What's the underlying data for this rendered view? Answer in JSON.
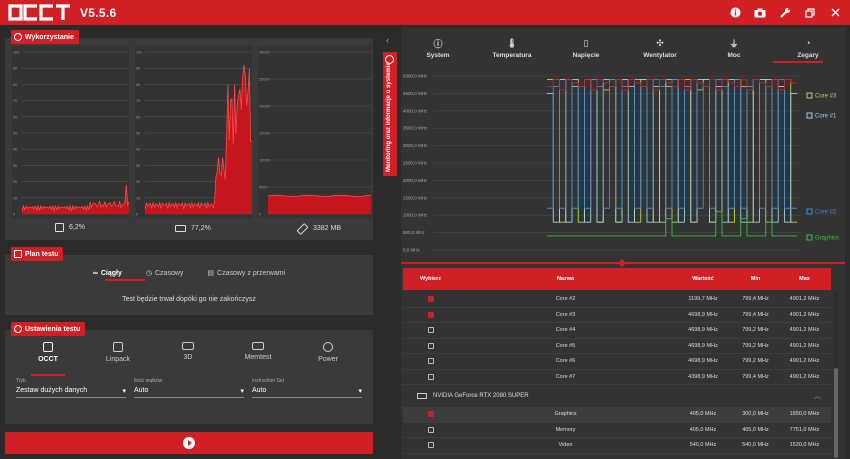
{
  "app": {
    "version": "V5.5.6"
  },
  "window_controls": [
    "info-icon",
    "camera-icon",
    "wrench-icon",
    "restore-icon",
    "close-icon"
  ],
  "usage": {
    "title": "Wykorzystanie",
    "graph1": {
      "y_ticks": [
        "100",
        "90",
        "80",
        "70",
        "60",
        "50",
        "40",
        "30",
        "20",
        "10",
        "0"
      ],
      "caption": "6,2%"
    },
    "graph2": {
      "y_ticks": [
        "100",
        "90",
        "80",
        "70",
        "60",
        "50",
        "40",
        "30",
        "20",
        "10",
        "0"
      ],
      "caption": "77,2%"
    },
    "graph3": {
      "y_ticks": [
        "30000",
        "25000",
        "20000",
        "15000",
        "10000",
        "5000",
        "0"
      ],
      "caption": "3382 MB"
    }
  },
  "plan": {
    "title": "Plan testu",
    "modes": [
      "Ciągły",
      "Czasowy",
      "Czasowy z przerwami"
    ],
    "active_mode": 0,
    "description": "Test będzie trwał dopóki go nie zakończysz"
  },
  "settings": {
    "title": "Ustawienia testu",
    "tests": [
      "OCCT",
      "Linpack",
      "3D",
      "Memtest",
      "Power"
    ],
    "active_test": 0,
    "selects": [
      {
        "label": "Tryb",
        "value": "Zestaw dużych danych"
      },
      {
        "label": "Ilość wątków",
        "value": "Auto"
      },
      {
        "label": "Instruction Set",
        "value": "Auto"
      }
    ]
  },
  "monitor_tab": {
    "label": "Monitoring oraz informacje o systemie"
  },
  "monitor": {
    "tabs": [
      "System",
      "Temperatura",
      "Napięcie",
      "Wentylator",
      "Moc",
      "Zegary"
    ],
    "tab_icons": [
      "info-icon",
      "thermometer-icon",
      "battery-icon",
      "fan-icon",
      "plug-icon",
      "gauge-icon"
    ],
    "active_tab": 5
  },
  "chart_data": {
    "type": "line",
    "y_ticks": [
      "5000,0 MHz",
      "4500,0 MHz",
      "4000,0 MHz",
      "3500,0 MHz",
      "3000,0 MHz",
      "2500,0 MHz",
      "2000,0 MHz",
      "1500,0 MHz",
      "1000,0 MHz",
      "500,0 MHz",
      "0,0 MHz"
    ],
    "ylim": [
      0,
      5000
    ],
    "legend": [
      "Core #3",
      "Core #1",
      "Core #2",
      "Graphics"
    ],
    "legend_colors": [
      "#b9d64a",
      "#9ad3e6",
      "#3b8fd9",
      "#3fbf3f"
    ],
    "series": [
      {
        "name": "Core #3",
        "color": "#b9d64a",
        "values": [
          4900,
          4900,
          800,
          4900,
          4700,
          800,
          4900,
          4900,
          800,
          4600,
          4900,
          800,
          4900,
          4700,
          800,
          4900,
          4900,
          800,
          4900,
          4700,
          800,
          4900,
          4900,
          800,
          4600,
          4900,
          800,
          4900,
          4900,
          800,
          4900,
          4700,
          800,
          4900,
          4900,
          800,
          4900,
          4700,
          4900,
          800
        ]
      },
      {
        "name": "Core #1",
        "color": "#9ad3e6",
        "values": [
          4500,
          800,
          4900,
          800,
          4900,
          4700,
          800,
          4900,
          800,
          4900,
          4700,
          800,
          4900,
          800,
          4900,
          4900,
          800,
          4700,
          800,
          4900,
          4900,
          800,
          4700,
          800,
          4900,
          4900,
          800,
          4700,
          800,
          4900,
          4900,
          800,
          4700,
          800,
          4900,
          4900,
          800,
          4700,
          800,
          4500
        ]
      },
      {
        "name": "Core #2",
        "color": "#3b8fd9",
        "values": [
          1200,
          4700,
          1200,
          4900,
          1200,
          4700,
          1200,
          4900,
          4700,
          1200,
          4900,
          1200,
          4700,
          4900,
          1200,
          4700,
          1200,
          4900,
          4700,
          1200,
          4900,
          1200,
          4700,
          4900,
          1200,
          4700,
          1200,
          4900,
          4700,
          1200,
          4900,
          1200,
          4700,
          4900,
          1200,
          4700,
          1200,
          4900,
          1200,
          1200
        ]
      },
      {
        "name": "Graphics",
        "color": "#3fbf3f",
        "values": [
          405,
          405,
          405,
          405,
          405,
          405,
          405,
          405,
          405,
          405,
          405,
          405,
          405,
          405,
          405,
          405,
          405,
          405,
          405,
          900,
          405,
          405,
          405,
          405,
          405,
          405,
          405,
          1100,
          405,
          405,
          405,
          900,
          405,
          405,
          405,
          800,
          405,
          405,
          405,
          405
        ]
      },
      {
        "name": "",
        "color": "#d01f25",
        "values": [
          4700,
          4900,
          4600,
          4900,
          4800,
          4700,
          4900,
          4600,
          4900,
          4800,
          4700,
          4900,
          4600,
          4900,
          4800,
          4700,
          4900,
          4600,
          4900,
          4800,
          4700,
          4900,
          4600,
          4900,
          4800,
          4700,
          4900,
          4600,
          4900,
          4800,
          4700,
          4900,
          4600,
          4900,
          4800,
          4700,
          4900,
          4600,
          4900,
          4800
        ]
      }
    ]
  },
  "table": {
    "headers": [
      "Wybierz",
      "Nazwa",
      "Wartość",
      "Min",
      "Max"
    ],
    "rows_cpu": [
      {
        "checked": true,
        "name": "Core #2",
        "value": "1199,7 MHz",
        "min": "799,4 MHz",
        "max": "4901,2 MHz"
      },
      {
        "checked": true,
        "name": "Core #3",
        "value": "4698,9 MHz",
        "min": "799,4 MHz",
        "max": "4901,2 MHz"
      },
      {
        "checked": false,
        "name": "Core #4",
        "value": "4698,9 MHz",
        "min": "799,2 MHz",
        "max": "4901,2 MHz"
      },
      {
        "checked": false,
        "name": "Core #5",
        "value": "4698,9 MHz",
        "min": "799,2 MHz",
        "max": "4901,2 MHz"
      },
      {
        "checked": false,
        "name": "Core #6",
        "value": "4698,9 MHz",
        "min": "799,2 MHz",
        "max": "4901,2 MHz"
      },
      {
        "checked": false,
        "name": "Core #7",
        "value": "4398,9 MHz",
        "min": "799,4 MHz",
        "max": "4901,2 MHz"
      }
    ],
    "gpu_group": "NVIDIA GeForce RTX 2080 SUPER",
    "rows_gpu": [
      {
        "checked": true,
        "name": "Graphics",
        "value": "405,0 MHz",
        "min": "300,0 MHz",
        "max": "1650,0 MHz"
      },
      {
        "checked": false,
        "name": "Memory",
        "value": "405,0 MHz",
        "min": "405,0 MHz",
        "max": "7751,0 MHz"
      },
      {
        "checked": false,
        "name": "Video",
        "value": "540,0 MHz",
        "min": "540,0 MHz",
        "max": "1530,0 MHz"
      }
    ]
  }
}
